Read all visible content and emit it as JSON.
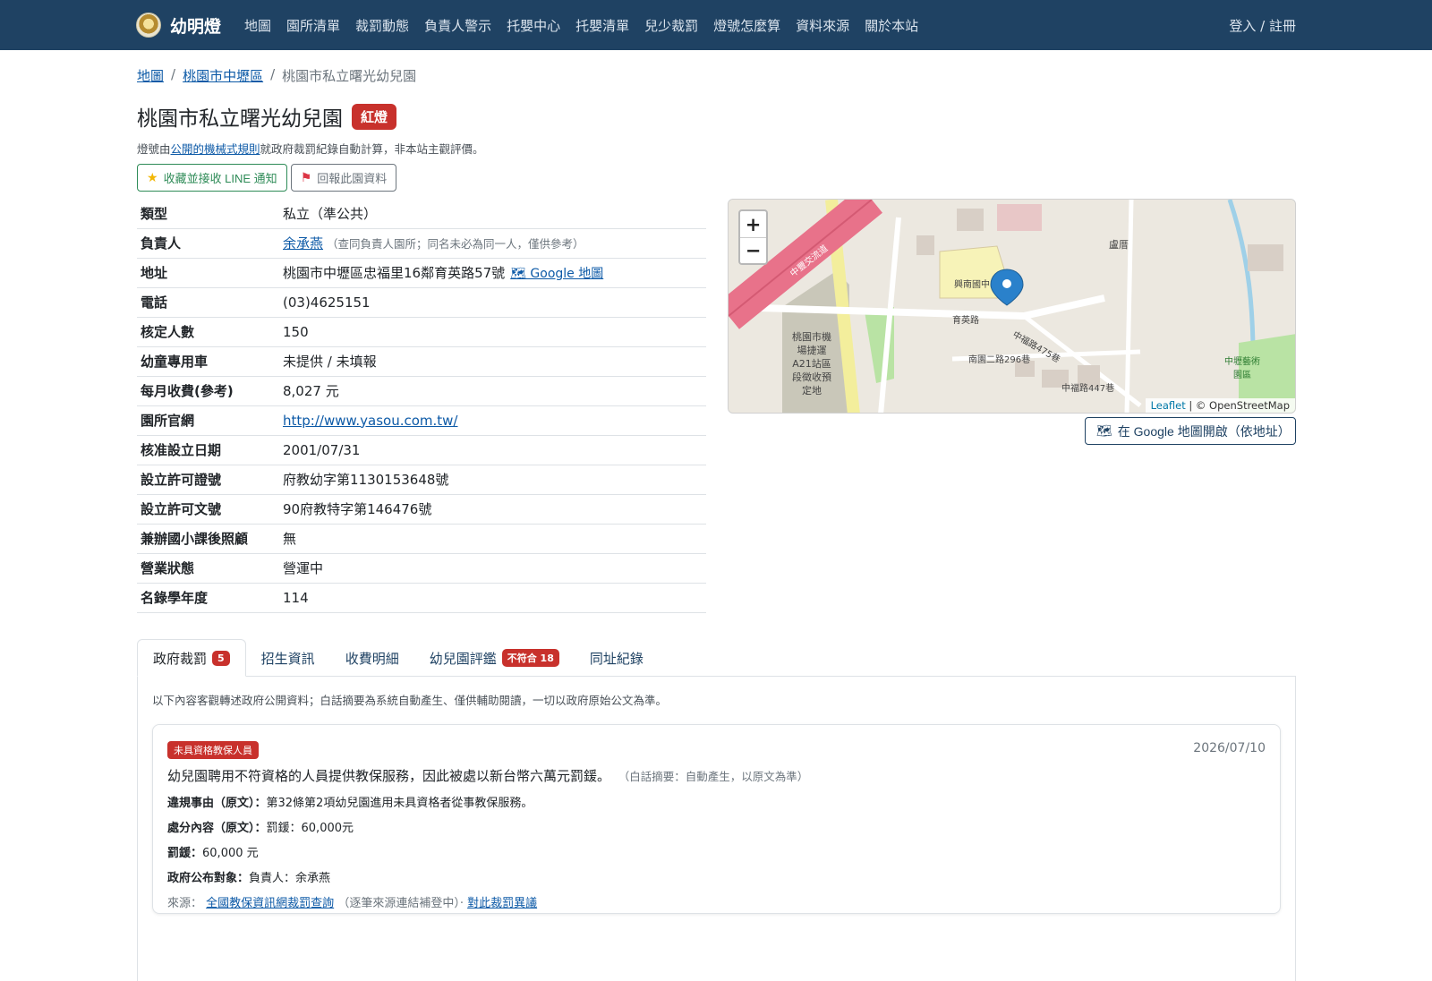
{
  "nav": {
    "brand": "幼明燈",
    "links": [
      "地圖",
      "園所清單",
      "裁罰動態",
      "負責人警示",
      "托嬰中心",
      "托嬰清單",
      "兒少裁罰",
      "燈號怎麼算",
      "資料來源",
      "關於本站"
    ],
    "login": "登入 / 註冊"
  },
  "breadcrumb": {
    "items": [
      "地圖",
      "桃園市中壢區",
      "桃園市私立曙光幼兒園"
    ],
    "sep": "/"
  },
  "header": {
    "title": "桃園市私立曙光幼兒園",
    "light": "紅燈",
    "note_prefix": "燈號由",
    "note_link": "公開的機械式規則",
    "note_suffix": "就政府裁罰紀錄自動計算，非本站主觀評價。",
    "btn_follow": "收藏並接收 LINE 通知",
    "btn_report": "回報此園資料"
  },
  "info": {
    "rows": [
      {
        "key": "類型",
        "value": "私立（準公共）"
      },
      {
        "key": "負責人",
        "value": "余承燕",
        "extra": "（查同負責人園所；同名未必為同一人，僅供參考）"
      },
      {
        "key": "地址",
        "value": "桃園市中壢區忠福里16鄰育英路57號",
        "extra": "🗺 Google 地圖"
      },
      {
        "key": "電話",
        "value": "(03)4625151"
      },
      {
        "key": "核定人數",
        "value": "150"
      },
      {
        "key": "幼童專用車",
        "value": "未提供 / 未填報"
      },
      {
        "key": "每月收費(參考)",
        "value": "8,027 元"
      },
      {
        "key": "園所官網",
        "value": "http://www.yasou.com.tw/"
      },
      {
        "key": "核准設立日期",
        "value": "2001/07/31"
      },
      {
        "key": "設立許可證號",
        "value": "府教幼字第1130153648號"
      },
      {
        "key": "設立許可文號",
        "value": "90府教特字第146476號"
      },
      {
        "key": "兼辦國小課後照顧",
        "value": "無"
      },
      {
        "key": "營業狀態",
        "value": "營運中"
      },
      {
        "key": "名錄學年度",
        "value": "114"
      }
    ]
  },
  "map": {
    "zoom_in": "+",
    "zoom_out": "−",
    "attr_leaflet": "Leaflet",
    "attr_osm": "| © OpenStreetMap",
    "open_google": "在 Google 地圖開啟（依地址）",
    "labels": {
      "school": "興南國中",
      "road1": "育英路",
      "road2": "南園二路296巷",
      "road3": "中福路475巷",
      "road4": "中福路447巷",
      "district": "桃園市機場捷運A21站區段徵收預定地",
      "luju": "盧厝",
      "art": "中壢藝術園區",
      "hw": "中豐交流道"
    },
    "colors": {
      "highway": "#e8728a",
      "school": "#f7f3b8",
      "park": "#b9e3a4",
      "marker": "#2a81cb"
    }
  },
  "tabs": [
    {
      "label": "政府裁罰",
      "badge": "5",
      "active": true
    },
    {
      "label": "招生資訊"
    },
    {
      "label": "收費明細"
    },
    {
      "label": "幼兒園評鑑",
      "badge": "不符合 18"
    },
    {
      "label": "同址紀錄"
    }
  ],
  "panel": {
    "note": "以下內容客觀轉述政府公開資料；白話摘要為系統自動產生、僅供輔助閱讀，一切以政府原始公文為準。",
    "card": {
      "badge": "未具資格教保人員",
      "date": "2026/07/10",
      "summary": "幼兒園聘用不符資格的人員提供教保服務，因此被處以新台幣六萬元罰鍰。",
      "summary_note": "（白話摘要：自動產生，以原文為準）",
      "reason_label": "違規事由（原文）：",
      "reason": "第32條第2項幼兒園進用未具資格者從事教保服務。",
      "penalty_label": "處分內容（原文）：",
      "penalty": "罰鍰：60,000元",
      "fine_label": "罰鍰：",
      "fine": "60,000 元",
      "target_label": "政府公布對象：",
      "target": "負責人：余承燕",
      "source_label": "來源：",
      "source_link": "全國教保資訊網裁罰查詢",
      "source_note": "（逐筆來源連結補登中）·",
      "appeal_link": "對此裁罰異議"
    }
  }
}
